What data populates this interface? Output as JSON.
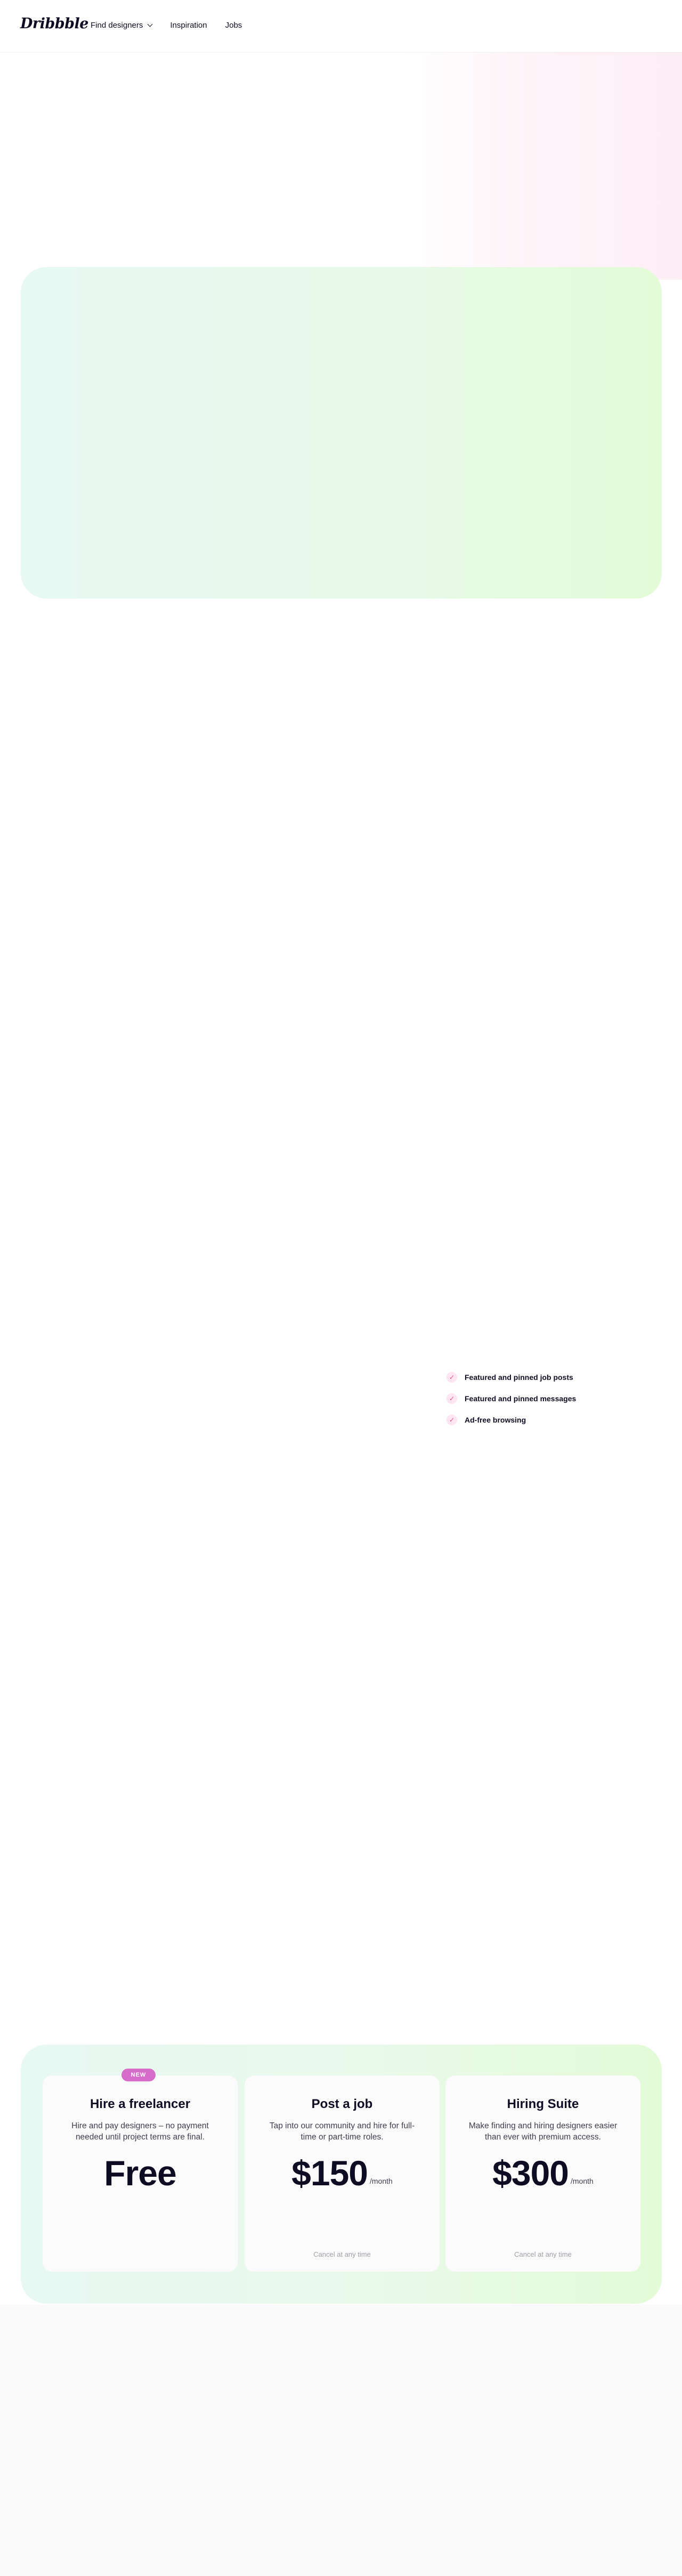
{
  "header": {
    "logo": "Dribbble",
    "nav": [
      {
        "label": "Find designers",
        "has_dropdown": true
      },
      {
        "label": "Inspiration"
      },
      {
        "label": "Jobs"
      }
    ]
  },
  "features": [
    "Featured and pinned job posts",
    "Featured and pinned messages",
    "Ad-free browsing"
  ],
  "pricing": {
    "badge": "NEW",
    "plans": [
      {
        "title": "Hire a freelancer",
        "description": "Hire and pay designers – no payment needed until project terms are final.",
        "price": "Free",
        "period": "",
        "note": ""
      },
      {
        "title": "Post a job",
        "description": "Tap into our community and hire for full-time or part-time roles.",
        "price": "$150",
        "period": "/month",
        "note": "Cancel at any time"
      },
      {
        "title": "Hiring Suite",
        "description": "Make finding and hiring designers easier than ever with premium access.",
        "price": "$300",
        "period": "/month",
        "note": "Cancel at any time"
      }
    ]
  },
  "colors": {
    "accent": "#ea4c89",
    "badge": "#d56cc9",
    "text": "#0d0c22"
  }
}
